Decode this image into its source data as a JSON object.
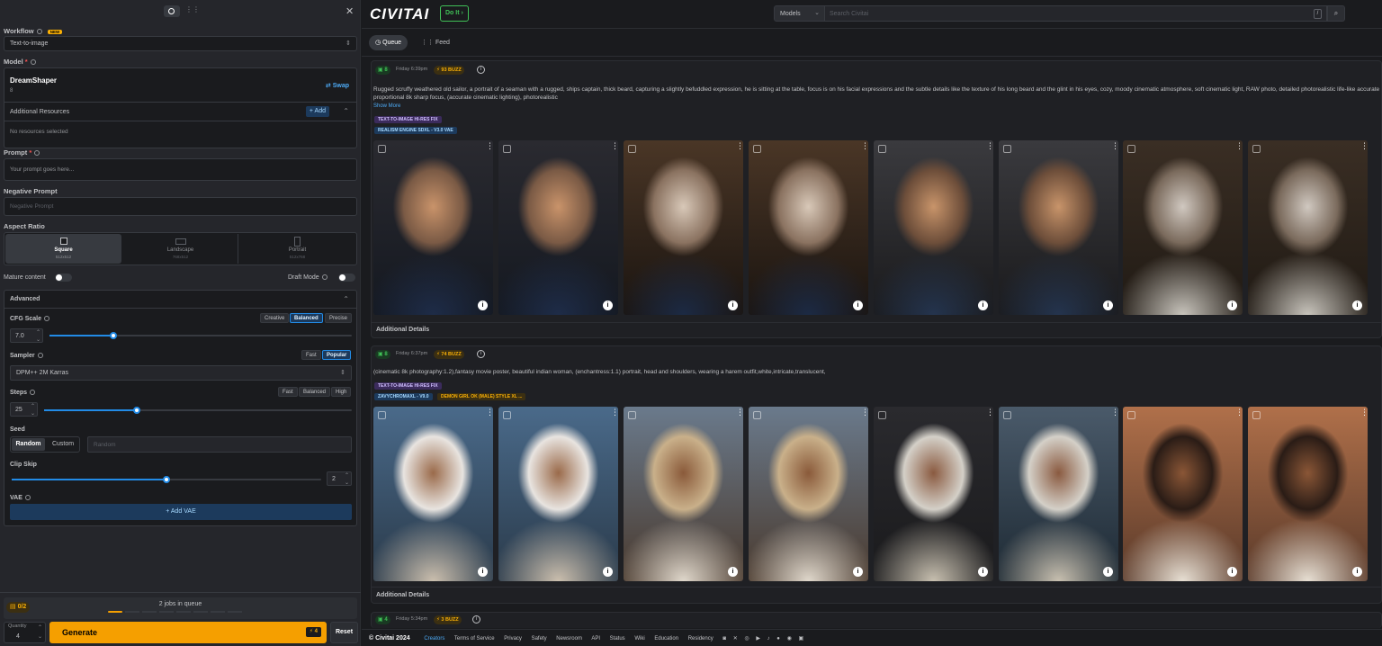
{
  "panel": {
    "workflow_label": "Workflow",
    "workflow_badge": "NEW",
    "workflow_value": "Text-to-image",
    "model_label": "Model",
    "model_name": "DreamShaper",
    "model_version": "8",
    "swap_label": "Swap",
    "additional_resources": "Additional Resources",
    "add_label": "+ Add",
    "no_resources": "No resources selected",
    "prompt_label": "Prompt",
    "prompt_placeholder": "Your prompt goes here...",
    "neg_label": "Negative Prompt",
    "neg_placeholder": "Negative Prompt",
    "aspect_label": "Aspect Ratio",
    "aspects": [
      {
        "name": "Square",
        "size": "512x512"
      },
      {
        "name": "Landscape",
        "size": "768x512"
      },
      {
        "name": "Portrait",
        "size": "512x768"
      }
    ],
    "mature_label": "Mature content",
    "draft_label": "Draft Mode",
    "advanced_label": "Advanced",
    "cfg_label": "CFG Scale",
    "cfg_presets": [
      "Creative",
      "Balanced",
      "Precise"
    ],
    "cfg_value": "7.0",
    "cfg_fraction": 0.21,
    "sampler_label": "Sampler",
    "sampler_presets": [
      "Fast",
      "Popular"
    ],
    "sampler_value": "DPM++ 2M Karras",
    "steps_label": "Steps",
    "steps_presets": [
      "Fast",
      "Balanced",
      "High"
    ],
    "steps_value": "25",
    "steps_fraction": 0.3,
    "seed_label": "Seed",
    "seed_modes": [
      "Random",
      "Custom"
    ],
    "seed_placeholder": "Random",
    "clip_label": "Clip Skip",
    "clip_value": "2",
    "clip_fraction": 0.5,
    "vae_label": "VAE",
    "add_vae": "+ Add VAE",
    "queue_count": "0/2",
    "jobs_text": "2 jobs in queue",
    "quantity_label": "Quantity",
    "quantity_value": "4",
    "generate_label": "Generate",
    "generate_cost": "4",
    "reset_label": "Reset"
  },
  "header": {
    "logo": "CIVITAI",
    "doit": "Do It",
    "search_scope": "Models",
    "search_placeholder": "Search Civitai",
    "slash": "/"
  },
  "tabs": {
    "queue": "Queue",
    "feed": "Feed"
  },
  "cards": [
    {
      "count": "8",
      "time": "Friday 6:39pm",
      "buzz": "93 BUZZ",
      "prompt": "Rugged scruffy weathered old sailor, a portrait of a seaman with a rugged, ships captain, thick beard, capturing a slightly befuddled expression, he is sitting at the table, focus is on his facial expressions and the subtle details like the texture of his long beard and the glint in his eyes, cozy, moody cinematic atmosphere, soft cinematic light, RAW photo, detailed photorealistic life-like accurate proportional 8k sharp focus, (accurate cinematic lighting), photorealistic",
      "show_more": "Show More",
      "tags": [
        "TEXT-TO-IMAGE HI-RES FIX",
        "REALISM ENGINE SDXL - V3.0 VAE"
      ],
      "details": "Additional Details"
    },
    {
      "count": "8",
      "time": "Friday 6:37pm",
      "buzz": "74 BUZZ",
      "prompt": "(cinematic 8k photography:1.2),fantasy movie poster, beautiful indian woman, (enchantress:1.1) portrait, head and shoulders, wearing a harem outfit,white,intricate,translucent,",
      "tags": [
        "TEXT-TO-IMAGE HI-RES FIX",
        "ZAVYCHROMAXL - V9.0",
        "DEMON GIRL OK (MALE) STYLE XL ..."
      ],
      "details": "Additional Details"
    },
    {
      "count": "4",
      "time": "Friday 5:34pm",
      "buzz": "3 BUZZ"
    }
  ],
  "footer": {
    "copyright": "© Civitai 2024",
    "links": [
      "Creators",
      "Terms of Service",
      "Privacy",
      "Safety",
      "Newsroom",
      "API",
      "Status",
      "Wiki",
      "Education",
      "Residency"
    ]
  },
  "colors": {
    "accent": "#228be6",
    "generate": "#f59f00",
    "buzz": "#fab005",
    "success": "#40c057"
  }
}
